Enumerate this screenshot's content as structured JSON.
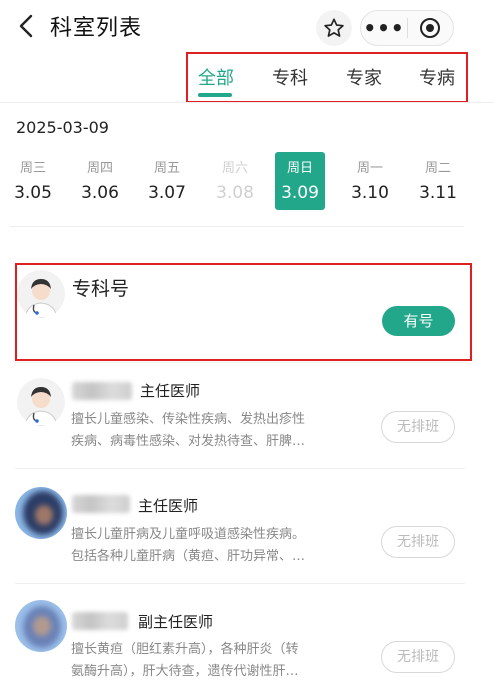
{
  "header": {
    "title": "科室列表",
    "more_label": "•••"
  },
  "tabs": [
    {
      "label": "全部",
      "active": true
    },
    {
      "label": "专科",
      "active": false
    },
    {
      "label": "专家",
      "active": false
    },
    {
      "label": "专病",
      "active": false
    }
  ],
  "date": "2025-03-09",
  "days": [
    {
      "name": "周三",
      "num": "3.05",
      "state": "normal"
    },
    {
      "name": "周四",
      "num": "3.06",
      "state": "normal"
    },
    {
      "name": "周五",
      "num": "3.07",
      "state": "normal"
    },
    {
      "name": "周六",
      "num": "3.08",
      "state": "faded"
    },
    {
      "name": "周日",
      "num": "3.09",
      "state": "selected"
    },
    {
      "name": "周一",
      "num": "3.10",
      "state": "normal"
    },
    {
      "name": "周二",
      "num": "3.11",
      "state": "normal"
    }
  ],
  "specialty": {
    "title": "专科号",
    "button": "有号"
  },
  "doctors": [
    {
      "title": "主任医师",
      "desc1": "擅长儿童感染、传染性疾病、发热出疹性",
      "desc2": "疾病、病毒性感染、对发热待查、肝脾…",
      "button": "无排班"
    },
    {
      "title": "主任医师",
      "desc1": "擅长儿童肝病及儿童呼吸道感染性疾病。",
      "desc2": "包括各种儿童肝病（黄疸、肝功异常、…",
      "button": "无排班"
    },
    {
      "title": "副主任医师",
      "desc1": "擅长黄疸（胆红素升高），各种肝炎（转",
      "desc2": "氨酶升高），肝大待查，遗传代谢性肝…",
      "button": "无排班"
    }
  ],
  "colors": {
    "accent": "#23a78a",
    "highlight_border": "#e02020"
  },
  "icons": [
    "back-icon",
    "star-icon",
    "more-icon",
    "target-icon",
    "doctor-avatar-icon"
  ]
}
